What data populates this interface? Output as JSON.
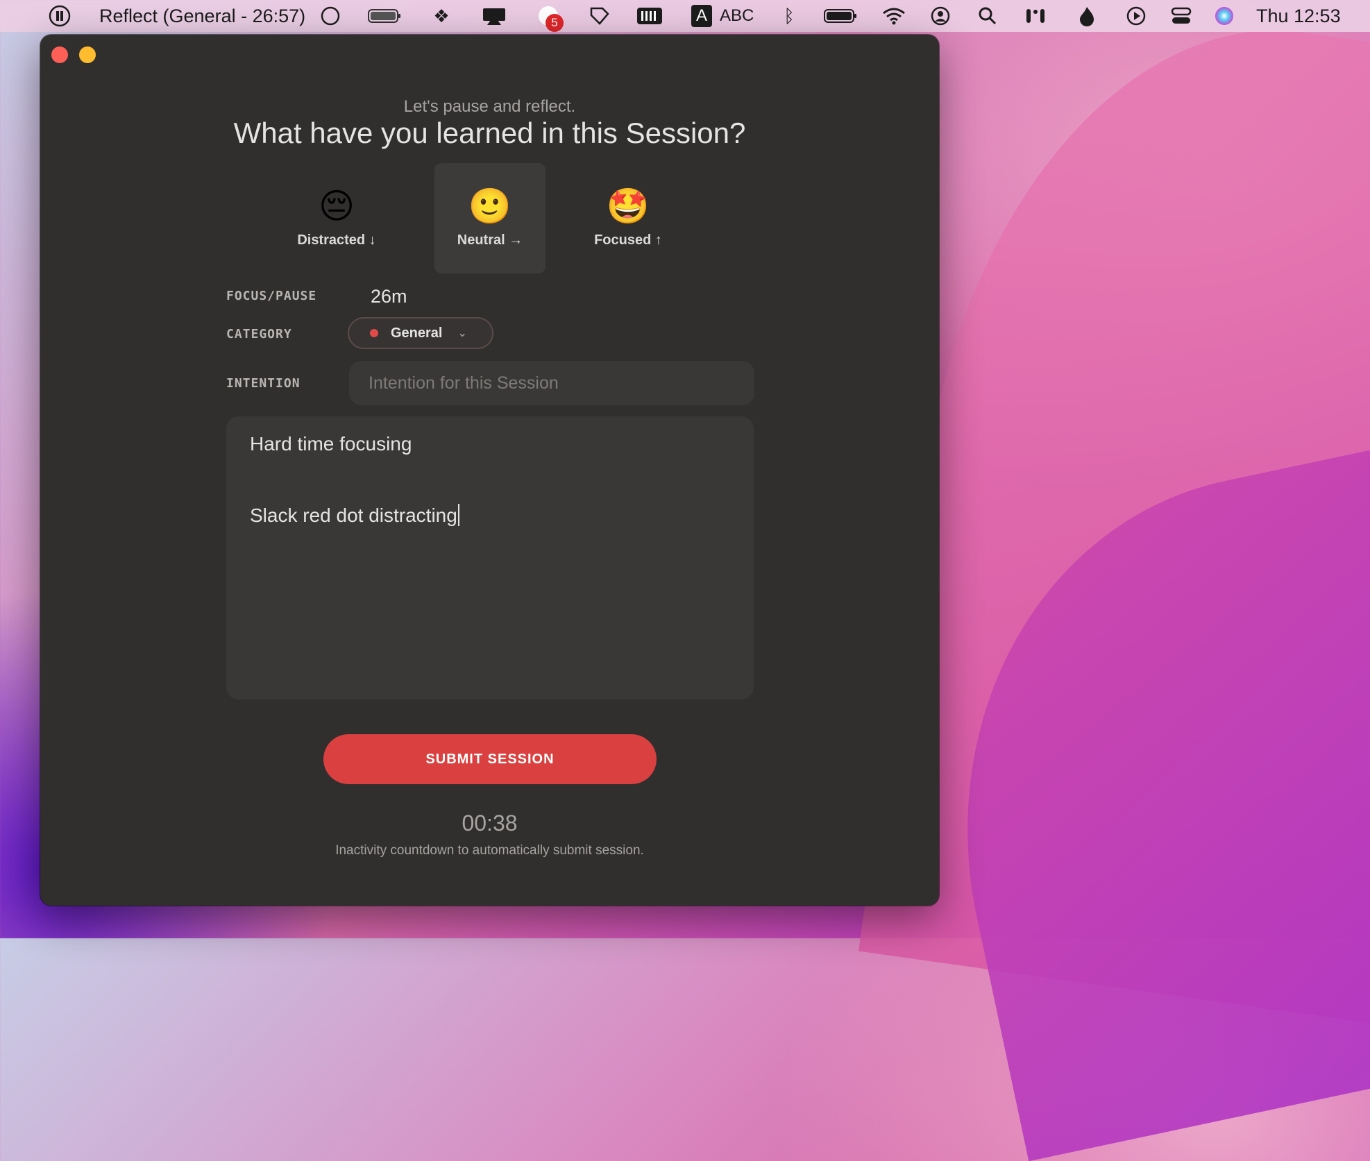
{
  "menubar": {
    "app_status": "Reflect (General - 26:57)",
    "notification_count": "5",
    "input_source": "ABC",
    "clock": "Thu 12:53",
    "input_letter": "A"
  },
  "window": {
    "subtitle": "Let's pause and reflect.",
    "title": "What have you learned in this Session?",
    "moods": [
      {
        "emoji": "😔",
        "label": "Distracted ↓"
      },
      {
        "emoji": "🙂",
        "label": "Neutral →",
        "selected": true
      },
      {
        "emoji": "🤩",
        "label": "Focused ↑"
      }
    ],
    "fields": {
      "focus_label": "FOCUS/PAUSE",
      "focus_value": "26m",
      "category_label": "CATEGORY",
      "category_value": "General",
      "category_color": "#e24a4a",
      "intention_label": "INTENTION",
      "intention_placeholder": "Intention for this Session"
    },
    "notes": {
      "line1": "Hard time focusing",
      "line2": "Slack red dot distracting"
    },
    "submit_label": "SUBMIT SESSION",
    "countdown": "00:38",
    "countdown_note": "Inactivity countdown to automatically submit session."
  },
  "colors": {
    "window_bg": "#312f2e",
    "accent": "#d9403f"
  }
}
